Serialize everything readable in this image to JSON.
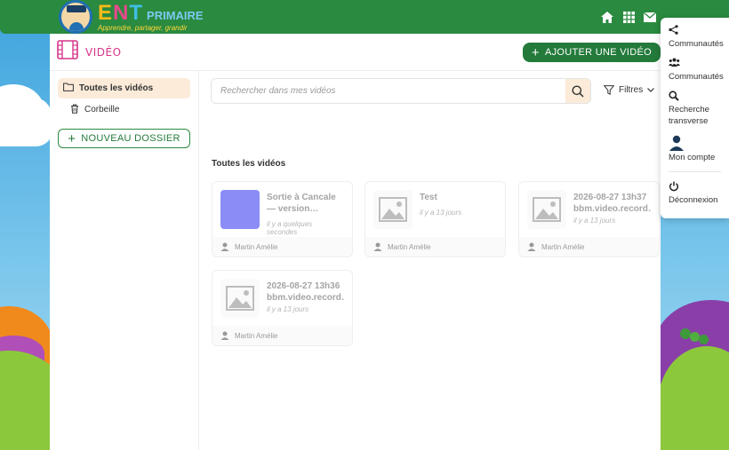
{
  "header": {
    "logo_ent": "ENT",
    "logo_primaire": "PRIMAIRE",
    "logo_tagline": "Apprendre, partager, grandir",
    "icons": [
      "home-icon",
      "apps-grid-icon",
      "mail-icon"
    ]
  },
  "app": {
    "title": "VIDÉO",
    "add_button": "AJOUTER UNE VIDÉO"
  },
  "sidebar": {
    "items": [
      {
        "label": "Toutes les vidéos",
        "icon": "folder-icon",
        "active": true
      },
      {
        "label": "Corbeille",
        "icon": "trash-icon",
        "active": false
      }
    ],
    "new_folder": "NOUVEAU DOSSIER"
  },
  "search": {
    "placeholder": "Rechercher dans mes vidéos",
    "filters_label": "Filtres"
  },
  "section_title": "Toutes les vidéos",
  "videos": [
    {
      "title": "Sortie à Cancale — version montée…",
      "date": "il y a quelques secondes",
      "author": "Martin Amélie",
      "thumb": "purple"
    },
    {
      "title": "Test",
      "date": "il y a 13 jours",
      "author": "Martin Amélie",
      "thumb": "placeholder"
    },
    {
      "title": "2026-08-27 13h37 bbm.video.record…",
      "date": "il y a 13 jours",
      "author": "Martin Amélie",
      "thumb": "placeholder"
    },
    {
      "title": "2026-08-27 13h36 bbm.video.record…",
      "date": "il y a 13 jours",
      "author": "Martin Amélie",
      "thumb": "placeholder"
    }
  ],
  "menu": {
    "items": [
      {
        "label": "Communautés",
        "icon": "share-icon"
      },
      {
        "label": "Communautés",
        "icon": "people-icon"
      },
      {
        "label": "Recherche transverse",
        "icon": "search-icon"
      },
      {
        "label": "Mon compte",
        "icon": "user-icon"
      },
      {
        "label": "Déconnexion",
        "icon": "power-icon"
      }
    ]
  }
}
